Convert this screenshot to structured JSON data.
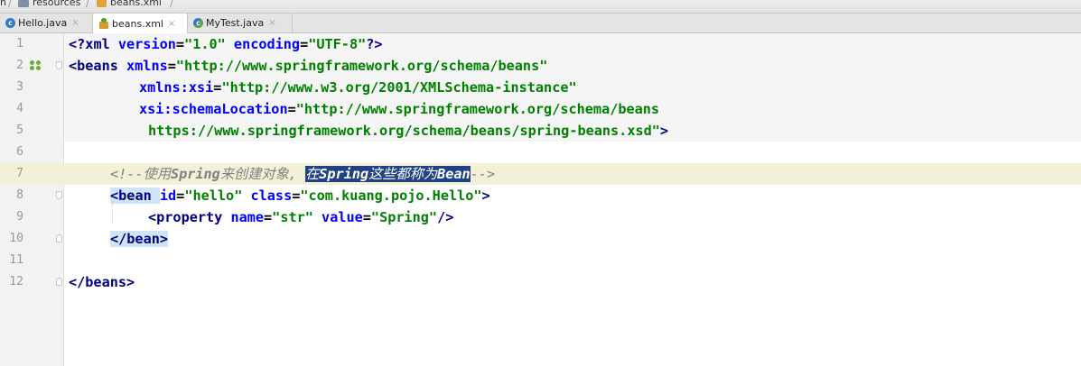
{
  "breadcrumb": {
    "items": [
      "n",
      "resources",
      "beans.xml"
    ]
  },
  "tabs": [
    {
      "label": "Hello.java",
      "icon": "java-class-icon"
    },
    {
      "label": "beans.xml",
      "icon": "spring-xml-icon",
      "active": true
    },
    {
      "label": "MyTest.java",
      "icon": "java-class-icon"
    }
  ],
  "editor": {
    "line_numbers": [
      "1",
      "2",
      "3",
      "4",
      "5",
      "6",
      "7",
      "8",
      "9",
      "10",
      "11",
      "12"
    ],
    "lines": {
      "l1": [
        "<?",
        "xml ",
        "version",
        "=",
        "\"1.0\"",
        " ",
        "encoding",
        "=",
        "\"UTF-8\"",
        "?>"
      ],
      "l2": [
        "<beans ",
        "xmlns",
        "=",
        "\"http://www.springframework.org/schema/beans\""
      ],
      "l3": [
        "xmlns:xsi",
        "=",
        "\"http://www.w3.org/2001/XMLSchema-instance\""
      ],
      "l4": [
        "xsi:schemaLocation",
        "=",
        "\"http://www.springframework.org/schema/beans"
      ],
      "l5": [
        "https://www.springframework.org/schema/beans/spring-beans.xsd\"",
        ">"
      ],
      "l7": [
        "<!--",
        "使用",
        "Spring",
        "来创建对象,",
        " ",
        "在",
        "Spring",
        "这些都称为",
        "Bean",
        "-->"
      ],
      "l8": [
        "<",
        "bean ",
        "id",
        "=",
        "\"hello\"",
        " ",
        "class",
        "=",
        "\"com.kuang.pojo.Hello\"",
        ">"
      ],
      "l9": [
        "<property ",
        "name",
        "=",
        "\"str\"",
        " ",
        "value",
        "=",
        "\"Spring\"",
        "/>"
      ],
      "l10": [
        "</bean>"
      ],
      "l12": [
        "</beans>"
      ]
    }
  },
  "colors": {
    "tag": "#000080",
    "attribute": "#0000ff",
    "value": "#008000",
    "comment": "#808080",
    "current_line": "#f4f0d8",
    "selection": "#214283"
  }
}
